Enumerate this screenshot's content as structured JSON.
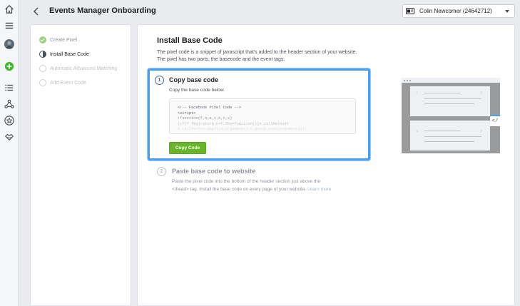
{
  "header": {
    "title": "Events Manager Onboarding",
    "account": "Colin Newcomer (24642712)"
  },
  "rail": {
    "icons": [
      "home-icon",
      "menu-icon",
      "avatar",
      "add-icon",
      "list-icon",
      "network-icon",
      "star-icon",
      "partners-icon"
    ]
  },
  "steps": [
    {
      "label": "Create Pixel",
      "state": "done"
    },
    {
      "label": "Install Base Code",
      "state": "current"
    },
    {
      "label": "Automatic Advanced Matching",
      "state": "pending"
    },
    {
      "label": "Add Event Code",
      "state": "pending"
    }
  ],
  "main": {
    "heading": "Install Base Code",
    "intro_line1": "The pixel code is a snippet of javascript that's added to the header section of your website.",
    "intro_line2": "The pixel has two parts: the basecode and the event tags.",
    "step1": {
      "number": "1",
      "title": "Copy base code",
      "description": "Copy the base code below.",
      "code_lines": [
        "<!-- Facebook Pixel Code -->",
        "<script>",
        "!function(f,b,e,v,n,t,s)",
        "{if(f.fbq)return;n=f.fbq=function(){n.callMethod?",
        "n.callMethod.apply(n,arguments):n.queue.push(arguments)};"
      ],
      "button_label": "Copy Code"
    },
    "step2": {
      "number": "2",
      "title": "Paste base code to website",
      "description_line1": "Paste the pixel code into the bottom of the header section just above the",
      "description_line2": "</head> tag. Install the base code on every page of your website.",
      "learn_more": "Learn more"
    },
    "illustration_tag": "</"
  },
  "colors": {
    "accent_blue": "#4a9df4",
    "button_green": "#69b42d",
    "done_green": "#9dd187"
  }
}
